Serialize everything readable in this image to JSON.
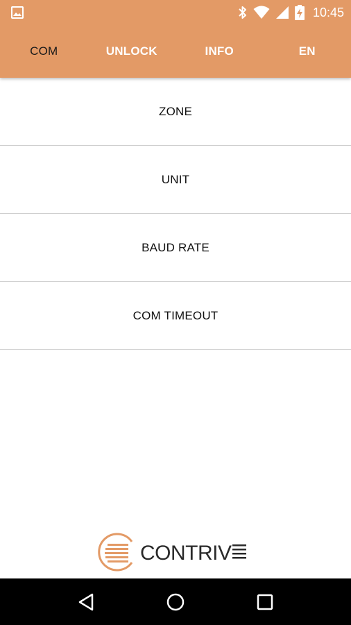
{
  "status_bar": {
    "time": "10:45",
    "icons": [
      "image-icon",
      "bluetooth-icon",
      "wifi-icon",
      "cellular-signal-icon",
      "battery-charging-icon"
    ]
  },
  "tabs": [
    {
      "label": "COM",
      "active": true
    },
    {
      "label": "UNLOCK",
      "active": false
    },
    {
      "label": "INFO",
      "active": false
    },
    {
      "label": "EN",
      "active": false
    }
  ],
  "menu": {
    "items": [
      {
        "label": "ZONE"
      },
      {
        "label": "UNIT"
      },
      {
        "label": "BAUD RATE"
      },
      {
        "label": "COM TIMEOUT"
      }
    ]
  },
  "logo": {
    "text": "CONTRIV"
  },
  "navbar": {
    "buttons": [
      "back-icon",
      "home-icon",
      "recents-icon"
    ]
  },
  "colors": {
    "header": "#E39A66",
    "logo_accent": "#E39A66",
    "navbar": "#000000"
  }
}
